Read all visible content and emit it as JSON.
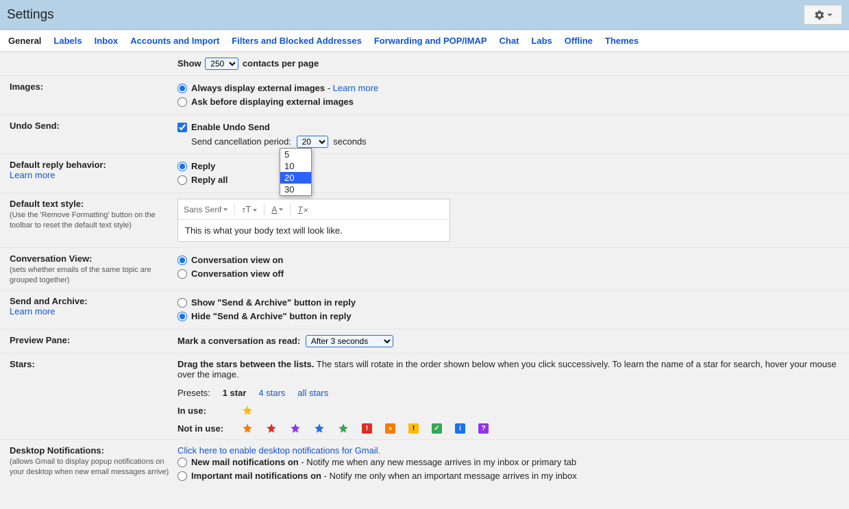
{
  "header": {
    "title": "Settings"
  },
  "tabs": [
    "General",
    "Labels",
    "Inbox",
    "Accounts and Import",
    "Filters and Blocked Addresses",
    "Forwarding and POP/IMAP",
    "Chat",
    "Labs",
    "Offline",
    "Themes"
  ],
  "active_tab": "General",
  "contacts": {
    "show": "Show",
    "value": "250",
    "suffix": "contacts per page"
  },
  "images": {
    "label": "Images:",
    "opt1": "Always display external images",
    "learn_more": "Learn more",
    "opt2": "Ask before displaying external images"
  },
  "undo": {
    "label": "Undo Send:",
    "enable": "Enable Undo Send",
    "period_label": "Send cancellation period:",
    "value": "20",
    "options": [
      "5",
      "10",
      "20",
      "30"
    ],
    "seconds": "seconds"
  },
  "reply": {
    "label": "Default reply behavior:",
    "learn_more": "Learn more",
    "opt1": "Reply",
    "opt2": "Reply all"
  },
  "textstyle": {
    "label": "Default text style:",
    "hint": "(Use the 'Remove Formatting' button on the toolbar to reset the default text style)",
    "font": "Sans Serif",
    "preview": "This is what your body text will look like."
  },
  "conv": {
    "label": "Conversation View:",
    "hint": "(sets whether emails of the same topic are grouped together)",
    "opt1": "Conversation view on",
    "opt2": "Conversation view off"
  },
  "sendarchive": {
    "label": "Send and Archive:",
    "learn_more": "Learn more",
    "opt1": "Show \"Send & Archive\" button in reply",
    "opt2": "Hide \"Send & Archive\" button in reply"
  },
  "preview": {
    "label": "Preview Pane:",
    "mark": "Mark a conversation as read:",
    "value": "After 3 seconds"
  },
  "stars": {
    "label": "Stars:",
    "drag_bold": "Drag the stars between the lists.",
    "drag_rest": "  The stars will rotate in the order shown below when you click successively. To learn the name of a star for search, hover your mouse over the image.",
    "presets": "Presets:",
    "p1": "1 star",
    "p4": "4 stars",
    "pall": "all stars",
    "in_use": "In use:",
    "not_in_use": "Not in use:"
  },
  "notif": {
    "label": "Desktop Notifications:",
    "hint": "(allows Gmail to display popup notifications on your desktop when new email messages arrive)",
    "enable_link": "Click here to enable desktop notifications for Gmail.",
    "opt1_b": "New mail notifications on",
    "opt1_t": " - Notify me when any new message arrives in my inbox or primary tab",
    "opt2_b": "Important mail notifications on",
    "opt2_t": " - Notify me only when an important message arrives in my inbox"
  }
}
